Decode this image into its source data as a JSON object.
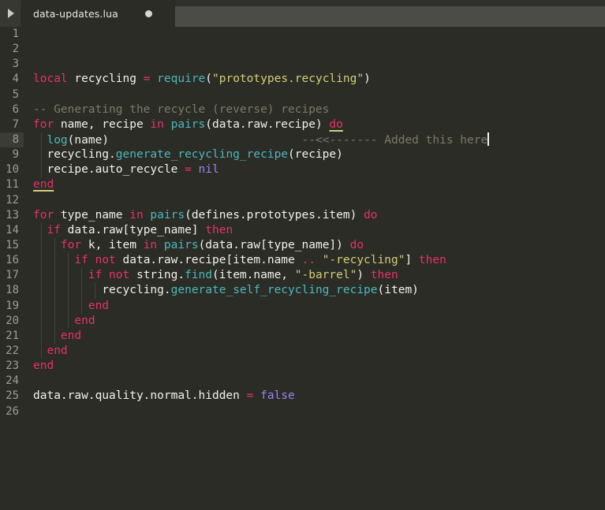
{
  "window": {
    "background_color": "#2b2c26",
    "tabbar_color": "#4b4c47"
  },
  "tabbar": {
    "run_icon": "play-triangle-icon",
    "tabs": [
      {
        "label": "data-updates.lua",
        "modified": true,
        "active": true
      }
    ]
  },
  "editor": {
    "language": "lua",
    "active_line": 8,
    "caret_line": 8,
    "total_visible_lines": 26,
    "theme_colors": {
      "background": "#2b2c26",
      "keyword": "#e6306d",
      "function": "#4bb8bd",
      "string": "#d5cd78",
      "comment": "#7b7a68",
      "constant": "#9f82f0",
      "text": "#f2f2ec",
      "line_number": "#9d9d93",
      "active_line_gutter": "#3b3c36",
      "bracket_match_underline": "#d5cd78"
    },
    "lines": [
      {
        "n": 1,
        "text": ""
      },
      {
        "n": 2,
        "text": ""
      },
      {
        "n": 3,
        "text": ""
      },
      {
        "n": 4,
        "text": "local recycling = require(\"prototypes.recycling\")"
      },
      {
        "n": 5,
        "text": ""
      },
      {
        "n": 6,
        "text": "-- Generating the recycle (reverse) recipes"
      },
      {
        "n": 7,
        "text": "for name, recipe in pairs(data.raw.recipe) do"
      },
      {
        "n": 8,
        "text": "  log(name)                            --<<------- Added this here"
      },
      {
        "n": 9,
        "text": "  recycling.generate_recycling_recipe(recipe)"
      },
      {
        "n": 10,
        "text": "  recipe.auto_recycle = nil"
      },
      {
        "n": 11,
        "text": "end"
      },
      {
        "n": 12,
        "text": ""
      },
      {
        "n": 13,
        "text": "for type_name in pairs(defines.prototypes.item) do"
      },
      {
        "n": 14,
        "text": "  if data.raw[type_name] then"
      },
      {
        "n": 15,
        "text": "    for k, item in pairs(data.raw[type_name]) do"
      },
      {
        "n": 16,
        "text": "      if not data.raw.recipe[item.name .. \"-recycling\"] then"
      },
      {
        "n": 17,
        "text": "        if not string.find(item.name, \"-barrel\") then"
      },
      {
        "n": 18,
        "text": "          recycling.generate_self_recycling_recipe(item)"
      },
      {
        "n": 19,
        "text": "        end"
      },
      {
        "n": 20,
        "text": "      end"
      },
      {
        "n": 21,
        "text": "    end"
      },
      {
        "n": 22,
        "text": "  end"
      },
      {
        "n": 23,
        "text": "end"
      },
      {
        "n": 24,
        "text": ""
      },
      {
        "n": 25,
        "text": "data.raw.quality.normal.hidden = false"
      },
      {
        "n": 26,
        "text": ""
      }
    ],
    "tokens": {
      "l4": {
        "kw_local": "local",
        "name": "recycling",
        "eq": "=",
        "fn": "require",
        "open": "(",
        "str": "\"prototypes.recycling\"",
        "close": ")"
      },
      "l6": {
        "comment": "-- Generating the recycle (reverse) recipes"
      },
      "l7": {
        "kw_for": "for",
        "vars": " name, recipe ",
        "kw_in": "in",
        "fn": " pairs",
        "args": "(data.raw.recipe) ",
        "kw_do": "do"
      },
      "l8": {
        "fn": "log",
        "args": "(name)",
        "comment": "--<<------- Added this here"
      },
      "l9": {
        "obj": "recycling.",
        "fn": "generate_recycling_recipe",
        "args": "(recipe)"
      },
      "l10": {
        "lhs": "recipe.auto_recycle ",
        "eq": "=",
        "const": " nil"
      },
      "l11": {
        "kw_end": "end"
      },
      "l13": {
        "kw_for": "for",
        "vars": " type_name ",
        "kw_in": "in",
        "fn": " pairs",
        "args": "(defines.prototypes.item) ",
        "kw_do": "do"
      },
      "l14": {
        "kw_if": "if",
        "expr": " data.raw[type_name] ",
        "kw_then": "then"
      },
      "l15": {
        "kw_for": "for",
        "vars": " k, item ",
        "kw_in": "in",
        "fn": " pairs",
        "args": "(data.raw[type_name]) ",
        "kw_do": "do"
      },
      "l16": {
        "kw_if": "if",
        "kw_not": " not",
        "expr": " data.raw.recipe[item.name ",
        "op": "..",
        "str": " \"-recycling\"",
        "expr2": "] ",
        "kw_then": "then"
      },
      "l17": {
        "kw_if": "if",
        "kw_not": " not",
        "obj": " string.",
        "fn": "find",
        "args": "(item.name, ",
        "str": "\"-barrel\"",
        "args2": ") ",
        "kw_then": "then"
      },
      "l18": {
        "obj": "recycling.",
        "fn": "generate_self_recycling_recipe",
        "args": "(item)"
      },
      "l19": {
        "kw_end": "end"
      },
      "l20": {
        "kw_end": "end"
      },
      "l21": {
        "kw_end": "end"
      },
      "l22": {
        "kw_end": "end"
      },
      "l23": {
        "kw_end": "end"
      },
      "l25": {
        "lhs": "data.raw.quality.normal.hidden ",
        "eq": "=",
        "const": " false"
      }
    }
  }
}
